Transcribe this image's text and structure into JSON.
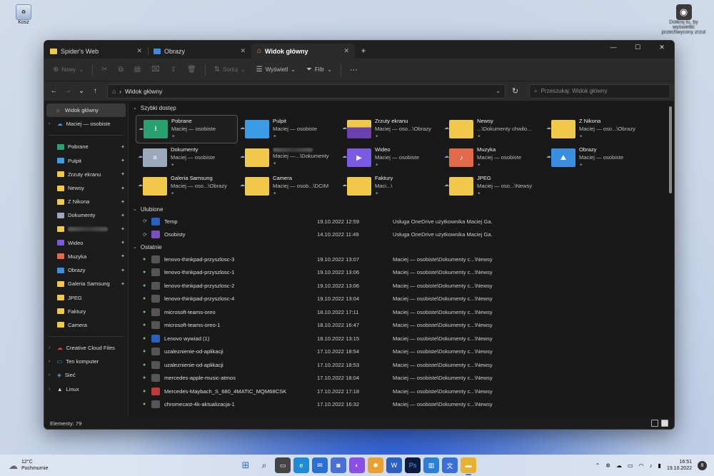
{
  "desktop": {
    "recycle_bin_label": "Kosz",
    "screenshot_label": "Dotknij tu, by wyświetlić przechwycony zrzut"
  },
  "window": {
    "tabs": [
      {
        "label": "Spider's Web"
      },
      {
        "label": "Obrazy"
      },
      {
        "label": "Widok główny"
      }
    ],
    "new_tab": "+",
    "controls": {
      "minimize": "—",
      "maximize": "☐",
      "close": "✕"
    }
  },
  "toolbar": {
    "new_label": "Nowy",
    "sort_label": "Sortuj",
    "view_label": "Wyświetl",
    "filter_label": "Filtr",
    "more_label": "···"
  },
  "address": {
    "path": "Widok główny",
    "search_placeholder": "Przeszukaj: Widok główny"
  },
  "sidebar": {
    "home": "Widok główny",
    "onedrive": "Maciej — osobiste",
    "pinned": [
      "Pobrane",
      "Pulpit",
      "Zrzuty ekranu",
      "Newsy",
      "Z Nikona",
      "Dokumenty",
      "",
      "Wideo",
      "Muzyka",
      "Obrazy",
      "Galeria Samsung",
      "JPEG",
      "Faktury",
      "Camera"
    ],
    "other": [
      "Creative Cloud Files",
      "Ten komputer",
      "Sieć",
      "Linux"
    ]
  },
  "sections": {
    "quick_access": "Szybki dostęp",
    "favorites": "Ulubione",
    "recent": "Ostatnie"
  },
  "quick_access": [
    {
      "name": "Pobrane",
      "sub": "Maciej — osobiste"
    },
    {
      "name": "Pulpit",
      "sub": "Maciej — osobiste"
    },
    {
      "name": "Zrzuty ekranu",
      "sub": "Maciej — oso...\\Obrazy"
    },
    {
      "name": "Newsy",
      "sub": "...\\Dokumenty chwilo..."
    },
    {
      "name": "Z Nikona",
      "sub": "Maciej — oso...\\Obrazy"
    },
    {
      "name": "Dokumenty",
      "sub": "Maciej — osobiste"
    },
    {
      "name": "",
      "sub": "Maciej —...\\Dokumenty"
    },
    {
      "name": "Wideo",
      "sub": "Maciej — osobiste"
    },
    {
      "name": "Muzyka",
      "sub": "Maciej — osobiste"
    },
    {
      "name": "Obrazy",
      "sub": "Maciej — osobiste"
    },
    {
      "name": "Galeria Samsung",
      "sub": "Maciej — oso...\\Obrazy"
    },
    {
      "name": "Camera",
      "sub": "Maciej — osob...\\DCIM"
    },
    {
      "name": "Faktury",
      "sub": "Maci...\\"
    },
    {
      "name": "JPEG",
      "sub": "Maciej — oso...\\Newsy"
    }
  ],
  "favorites": [
    {
      "name": "Temp",
      "date": "19.10.2022 12:59",
      "loc": "Usługa OneDrive użytkownika Maciej Ga..."
    },
    {
      "name": "Osobisty",
      "date": "14.10.2022 11:49",
      "loc": "Usługa OneDrive użytkownika Maciej Ga..."
    }
  ],
  "recent": [
    {
      "name": "lenovo-thinkpad-przyszlosc-3",
      "date": "19.10.2022 13:07",
      "loc": "Maciej — osobiste\\Dokumenty c...\\Newsy"
    },
    {
      "name": "lenovo-thinkpad-przyszlosc-1",
      "date": "19.10.2022 13:06",
      "loc": "Maciej — osobiste\\Dokumenty c...\\Newsy"
    },
    {
      "name": "lenovo-thinkpad-przyszlosc-2",
      "date": "19.10.2022 13:06",
      "loc": "Maciej — osobiste\\Dokumenty c...\\Newsy"
    },
    {
      "name": "lenovo-thinkpad-przyszlosc-4",
      "date": "19.10.2022 13:04",
      "loc": "Maciej — osobiste\\Dokumenty c...\\Newsy"
    },
    {
      "name": "microsoft-teams-oreo",
      "date": "18.10.2022 17:11",
      "loc": "Maciej — osobiste\\Dokumenty c...\\Newsy"
    },
    {
      "name": "microsoft-teams-oreo-1",
      "date": "18.10.2022 16:47",
      "loc": "Maciej — osobiste\\Dokumenty c...\\Newsy"
    },
    {
      "name": "Lenovo wywiad (1)",
      "date": "18.10.2022 13:15",
      "loc": "Maciej — osobiste\\Dokumenty c...\\Newsy"
    },
    {
      "name": "uzaleznienie-od-aplikacji",
      "date": "17.10.2022 18:54",
      "loc": "Maciej — osobiste\\Dokumenty c...\\Newsy"
    },
    {
      "name": "uzaleznienie-od-aplikacji",
      "date": "17.10.2022 18:53",
      "loc": "Maciej — osobiste\\Dokumenty c...\\Newsy"
    },
    {
      "name": "mercedes-apple-music-atmos",
      "date": "17.10.2022 18:04",
      "loc": "Maciej — osobiste\\Dokumenty c...\\Newsy"
    },
    {
      "name": "Mercedes-Maybach_S_680_4MATIC_MQM68CSK",
      "date": "17.10.2022 17:18",
      "loc": "Maciej — osobiste\\Dokumenty c...\\Newsy"
    },
    {
      "name": "chromecast-4k-aktualizacja-1",
      "date": "17.10.2022 16:32",
      "loc": "Maciej — osobiste\\Dokumenty c...\\Newsy"
    }
  ],
  "status": {
    "items": "Elementy: 79"
  },
  "taskbar": {
    "temp": "12°C",
    "weather": "Pochmurnie",
    "time": "16:51",
    "date": "19.10.2022",
    "notifications": "8"
  }
}
